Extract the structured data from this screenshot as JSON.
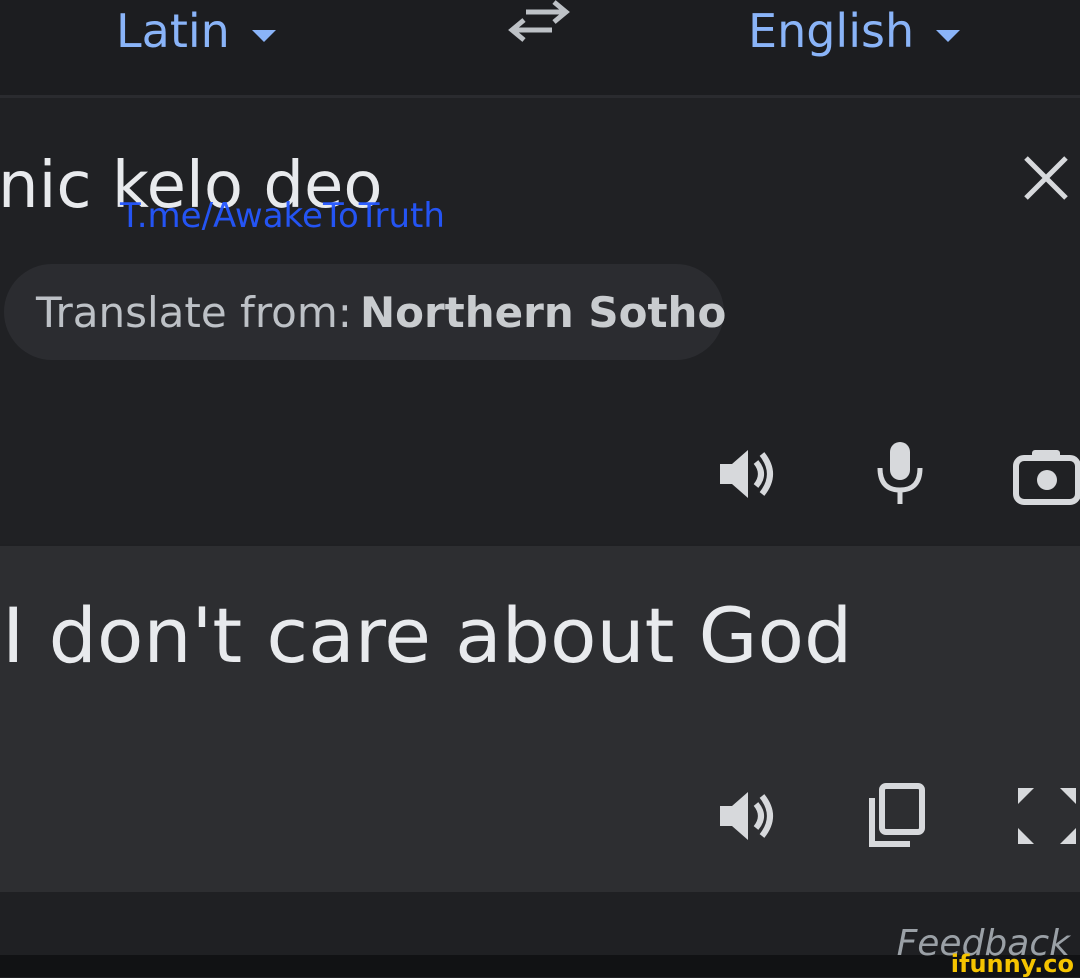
{
  "header": {
    "source_language": "Latin",
    "target_language": "English",
    "swap_icon": "swap-arrows-icon"
  },
  "input": {
    "source_text": "nic kelo deo",
    "watermark": "T.me/AwakeToTruth",
    "detected_prefix": "Translate from:",
    "detected_language": "Northern Sotho",
    "icons": [
      "speaker-icon",
      "microphone-icon",
      "camera-icon",
      "close-icon"
    ]
  },
  "output": {
    "translated_text": "I don't care about God",
    "icons": [
      "speaker-icon",
      "copy-icon",
      "fullscreen-icon"
    ]
  },
  "footer": {
    "feedback_label": "Feedback",
    "brand_watermark": "ifunny.co"
  },
  "colors": {
    "accent": "#8ab4f8",
    "background": "#202124",
    "output_background": "#2d2e31",
    "text": "#e8eaed",
    "watermark": "#2557ff",
    "brand": "#f5c400"
  }
}
